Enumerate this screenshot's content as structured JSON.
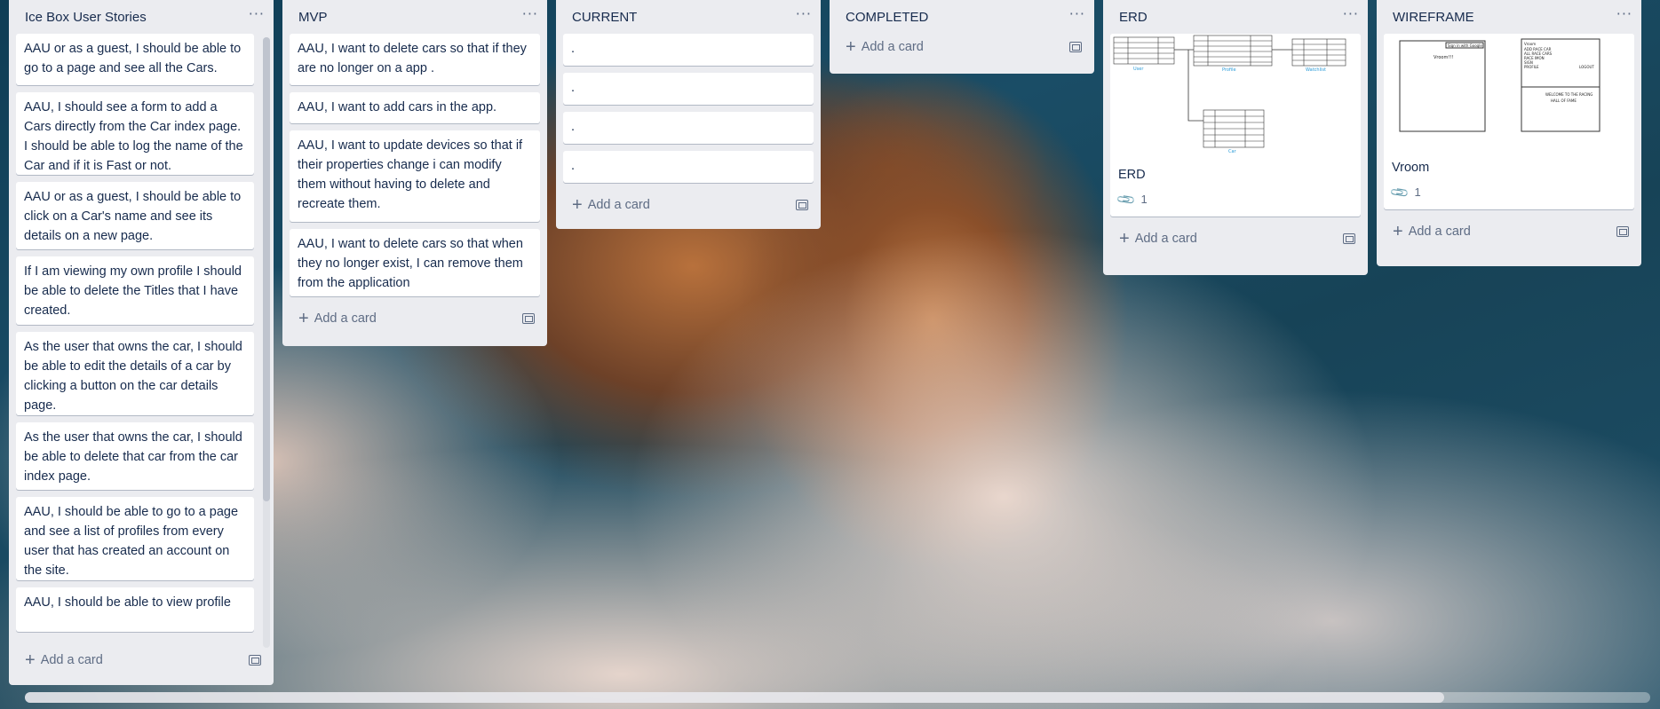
{
  "board": {
    "add_card_label": "Add a card",
    "menu_glyph": "···",
    "lists": [
      {
        "title": "Ice Box User Stories",
        "cards": [
          "AAU or as a guest, I should be able to go to a page and see all the Cars.",
          "AAU, I should see a form to add a Cars directly from the Car index page. I should be able to log the name of the Car and if it is Fast or not.",
          "AAU or as a guest, I should be able to click on a Car's name and see its details on a new page.",
          "If I am viewing my own profile I should be able to delete the Titles that I have created.",
          "As the user that owns the car, I should be able to edit the details of a car by clicking a button on the car details page.",
          "As the user that owns the car, I should be able to delete that car from the car index page.",
          "AAU, I should be able to go to a page and see a list of profiles from every user that has created an account on the site.",
          "AAU, I should be able to view profile"
        ]
      },
      {
        "title": "MVP",
        "cards": [
          "AAU, I want to delete cars so that if they are no longer on a app .",
          "AAU, I want to add cars in the app.",
          "AAU, I want to update devices so that if their properties change i can modify them without having to delete and recreate them.",
          "AAU, I want to delete cars so that when they no longer exist, I can remove them from the application"
        ]
      },
      {
        "title": "CURRENT",
        "cards": [
          ".",
          ".",
          ".",
          "."
        ]
      },
      {
        "title": "COMPLETED",
        "cards": []
      },
      {
        "title": "ERD",
        "cover_card": {
          "title": "ERD",
          "attachments": "1",
          "attachment_icon": "paperclip-icon"
        }
      },
      {
        "title": "WIREFRAME",
        "cover_card": {
          "title": "Vroom",
          "attachments": "1",
          "attachment_icon": "paperclip-icon"
        }
      }
    ]
  },
  "erd_labels": {
    "a": "User",
    "b": "Profile",
    "c": "Watchlist",
    "d": "Car"
  },
  "wireframe_labels": {
    "sign_in": "Sign in with Google",
    "left_title": "Vroom!!!",
    "right_menu_1": "Vroom",
    "right_menu_2": "ADD RACE CAR",
    "right_menu_3": "ALL RACE CARS",
    "right_menu_4": "RACE IMON",
    "right_menu_5": "SIGN",
    "right_menu_6": "PROFILE",
    "right_logout": "LOGOUT",
    "welcome_1": "WELCOME TO THE RACING",
    "welcome_2": "HALL OF FAME"
  }
}
